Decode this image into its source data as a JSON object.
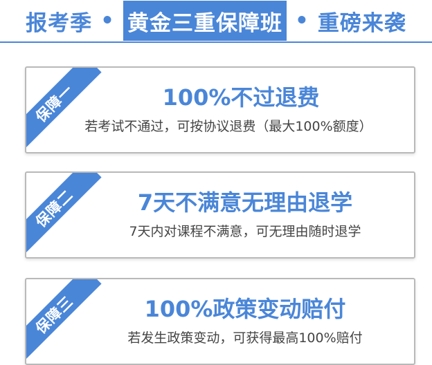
{
  "header": {
    "part1": "报考季",
    "dot": "•",
    "highlight": "黄金三重保障班",
    "part3": "重磅来袭",
    "colors": {
      "accent": "#4a86d8"
    }
  },
  "cards": [
    {
      "ribbon": "保障一",
      "title": "100%不过退费",
      "desc": "若考试不通过，可按协议退费（最大100%额度）"
    },
    {
      "ribbon": "保障二",
      "title": "7天不满意无理由退学",
      "desc": "7天内对课程不满意，可无理由随时退学"
    },
    {
      "ribbon": "保障三",
      "title": "100%政策变动赔付",
      "desc": "若发生政策变动，可获得最高100%赔付"
    }
  ]
}
